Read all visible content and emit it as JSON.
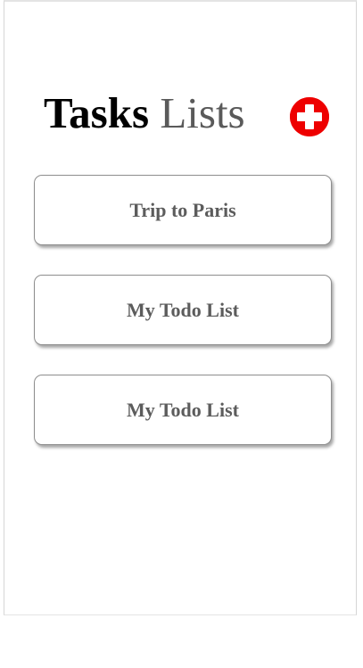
{
  "header": {
    "title_strong": "Tasks",
    "title_light": "Lists",
    "add_icon": "plus-circle-icon"
  },
  "colors": {
    "accent": "#ee0000",
    "title_dark": "#000000",
    "title_light": "#5a5a5a",
    "card_text": "#5c5c5c",
    "card_border": "#8e8e8e"
  },
  "lists": [
    {
      "label": "Trip to Paris"
    },
    {
      "label": "My Todo List"
    },
    {
      "label": "My Todo List"
    }
  ]
}
